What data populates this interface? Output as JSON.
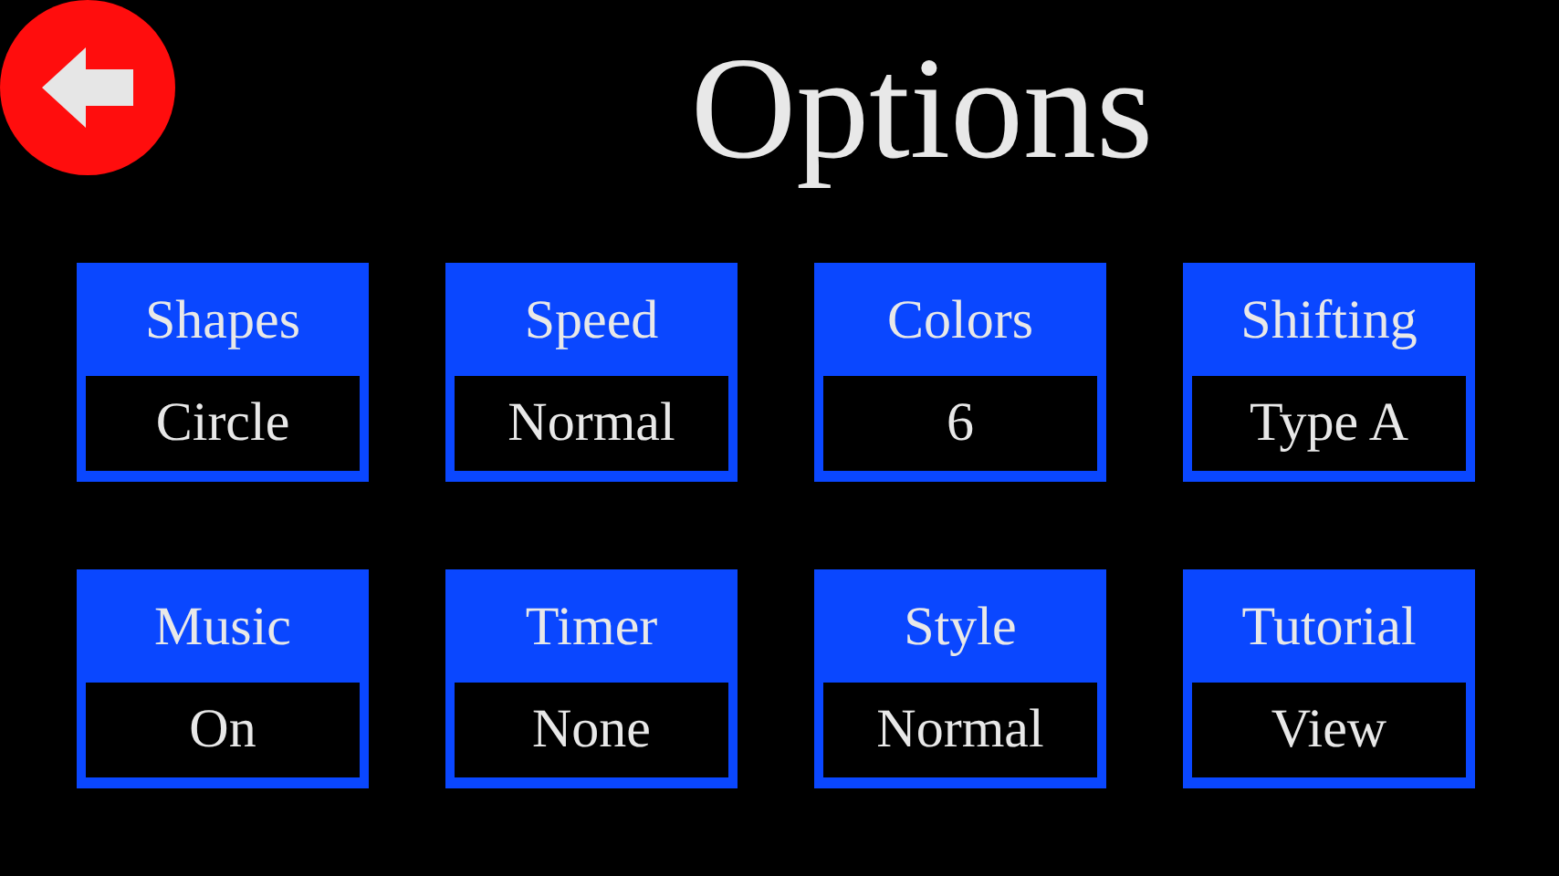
{
  "title": "Options",
  "options": [
    {
      "label": "Shapes",
      "value": "Circle"
    },
    {
      "label": "Speed",
      "value": "Normal"
    },
    {
      "label": "Colors",
      "value": "6"
    },
    {
      "label": "Shifting",
      "value": "Type A"
    },
    {
      "label": "Music",
      "value": "On"
    },
    {
      "label": "Timer",
      "value": "None"
    },
    {
      "label": "Style",
      "value": "Normal"
    },
    {
      "label": "Tutorial",
      "value": "View"
    }
  ]
}
